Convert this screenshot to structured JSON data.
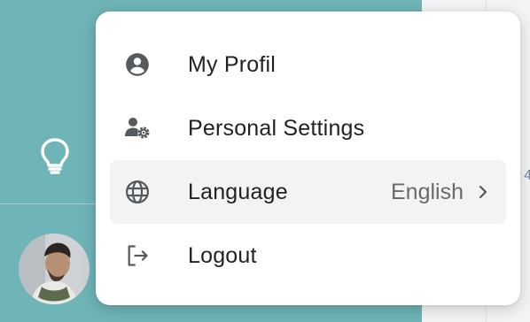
{
  "menu": {
    "items": [
      {
        "label": "My Profil",
        "icon": "account-circle-icon"
      },
      {
        "label": "Personal Settings",
        "icon": "user-settings-icon"
      },
      {
        "label": "Language",
        "icon": "globe-icon",
        "value": "English",
        "trailing_icon": "chevron-right-icon"
      },
      {
        "label": "Logout",
        "icon": "logout-icon"
      }
    ]
  },
  "sidebar": {
    "icon": "lightbulb-icon",
    "avatar": "user-avatar"
  },
  "background_page": {
    "partial_text": "4"
  },
  "colors": {
    "sidebar": "#6fb4b7",
    "menu_bg": "#ffffff",
    "active_item_bg": "#f3f3f3",
    "text": "#222222",
    "secondary_text": "#6a6a6a"
  }
}
